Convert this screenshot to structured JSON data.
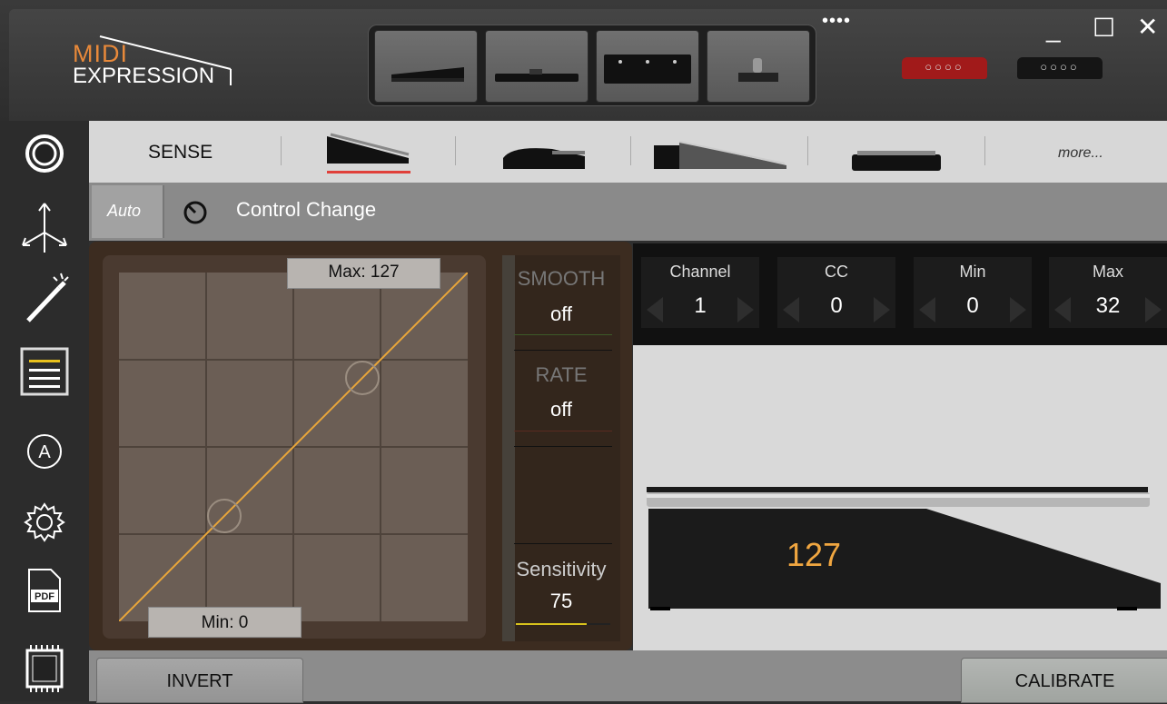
{
  "header": {
    "logo_top": "MIDI",
    "logo_bottom": "EXPRESSION",
    "menu_dots": "••••",
    "minimize": "_",
    "maximize": "☐",
    "close": "✕",
    "device_tray": [
      "expression-pedal",
      "sustain-pedal",
      "footswitch-3",
      "single-switch"
    ],
    "connectors": [
      "red-connector",
      "black-connector"
    ]
  },
  "sidebar": {
    "items": [
      "record-icon",
      "axis-icon",
      "magic-wand-icon",
      "list-icon",
      "auto-icon",
      "settings-icon",
      "pdf-icon",
      "chip-icon"
    ],
    "auto_glyph": "A",
    "pdf_text": "PDF"
  },
  "tabs": {
    "sense": "SENSE",
    "more": "more...",
    "pedals": [
      "expression-pedal-tab",
      "sustain-pedal-tab",
      "volume-pedal-tab",
      "flat-pedal-tab"
    ]
  },
  "mode": {
    "auto": "Auto",
    "type": "Control Change"
  },
  "curve": {
    "max_label": "Max: 127",
    "min_label": "Min: 0"
  },
  "params": {
    "smooth_label": "SMOOTH",
    "smooth_value": "off",
    "rate_label": "RATE",
    "rate_value": "off",
    "sensitivity_label": "Sensitivity",
    "sensitivity_value": "75"
  },
  "midi": [
    {
      "title": "Channel",
      "value": "1"
    },
    {
      "title": "CC",
      "value": "0"
    },
    {
      "title": "Min",
      "value": "0"
    },
    {
      "title": "Max",
      "value": "32"
    }
  ],
  "pedal": {
    "value": "127"
  },
  "bottom": {
    "invert": "INVERT",
    "calibrate": "CALIBRATE"
  },
  "colors": {
    "accent_orange": "#f0a640",
    "logo_orange": "#e8893a",
    "connector_red": "#a11a1a",
    "tab_underline": "#e0403a",
    "curve_line": "#e9a63a"
  }
}
